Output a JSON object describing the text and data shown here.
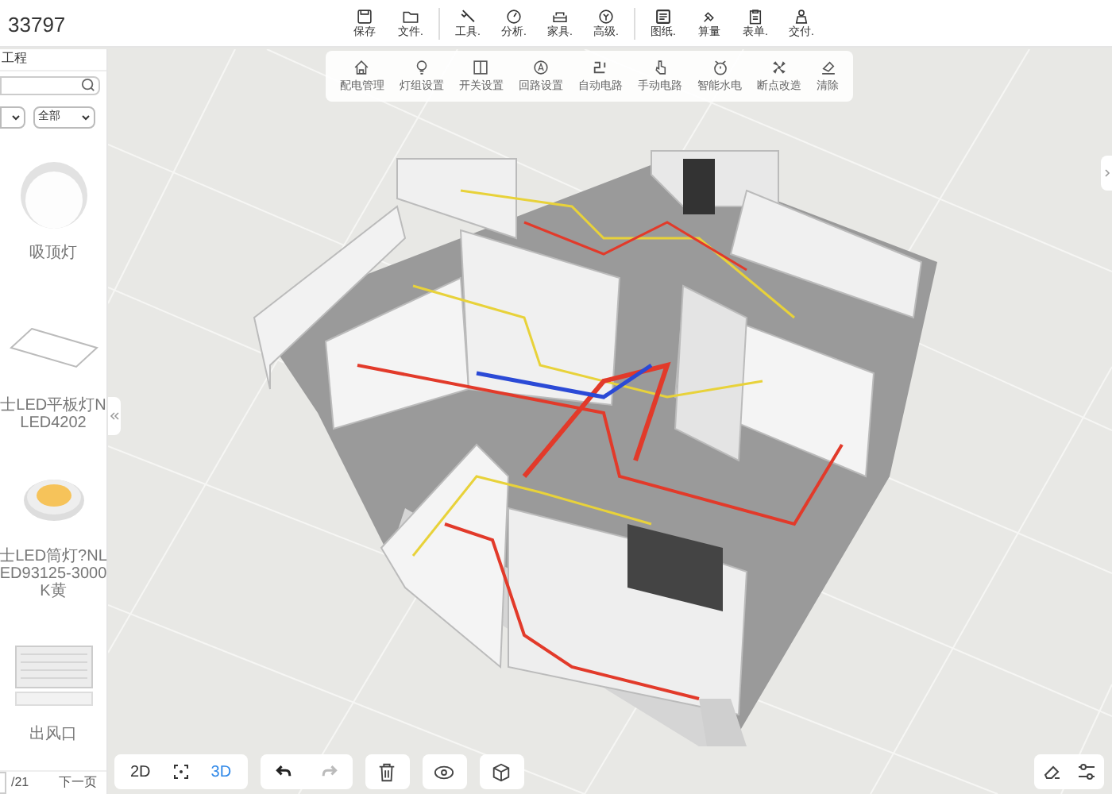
{
  "project_title": "33797",
  "toolbar_groups": [
    [
      {
        "label": "保存",
        "kind": "save"
      },
      {
        "label": "文件.",
        "kind": "folder"
      }
    ],
    [
      {
        "label": "工具.",
        "kind": "wrench"
      },
      {
        "label": "分析.",
        "kind": "gauge"
      },
      {
        "label": "家具.",
        "kind": "sofa"
      },
      {
        "label": "高级.",
        "kind": "badge"
      }
    ],
    [
      {
        "label": "图纸.",
        "kind": "sheet"
      },
      {
        "label": "算量",
        "kind": "brush"
      },
      {
        "label": "表单.",
        "kind": "clipboard"
      },
      {
        "label": "交付.",
        "kind": "person"
      }
    ]
  ],
  "electric_menu": [
    {
      "label": "配电管理",
      "kind": "house"
    },
    {
      "label": "灯组设置",
      "kind": "bulb"
    },
    {
      "label": "开关设置",
      "kind": "switch"
    },
    {
      "label": "回路设置",
      "kind": "circleA"
    },
    {
      "label": "自动电路",
      "kind": "auto"
    },
    {
      "label": "手动电路",
      "kind": "hand"
    },
    {
      "label": "智能水电",
      "kind": "timer"
    },
    {
      "label": "断点改造",
      "kind": "fan"
    },
    {
      "label": "清除",
      "kind": "eraser"
    }
  ],
  "sidebar": {
    "title": "工程",
    "filter": "全部",
    "items": [
      {
        "name": "吸顶灯",
        "kind": "ceiling"
      },
      {
        "name": "士LED平板灯NLED4202",
        "kind": "panel"
      },
      {
        "name": "士LED筒灯?NLED93125-3000K黄",
        "kind": "downlight"
      },
      {
        "name": "出风口",
        "kind": "vent"
      }
    ],
    "pagination": {
      "total": "/21",
      "next": "下一页"
    }
  },
  "view_controls": [
    {
      "label": "2D",
      "kind": "text",
      "selected": false
    },
    {
      "kind": "focus",
      "selected": false
    },
    {
      "label": "3D",
      "kind": "text",
      "selected": true
    }
  ],
  "history": [
    {
      "kind": "undo",
      "disabled": false
    },
    {
      "kind": "redo",
      "disabled": true
    }
  ]
}
